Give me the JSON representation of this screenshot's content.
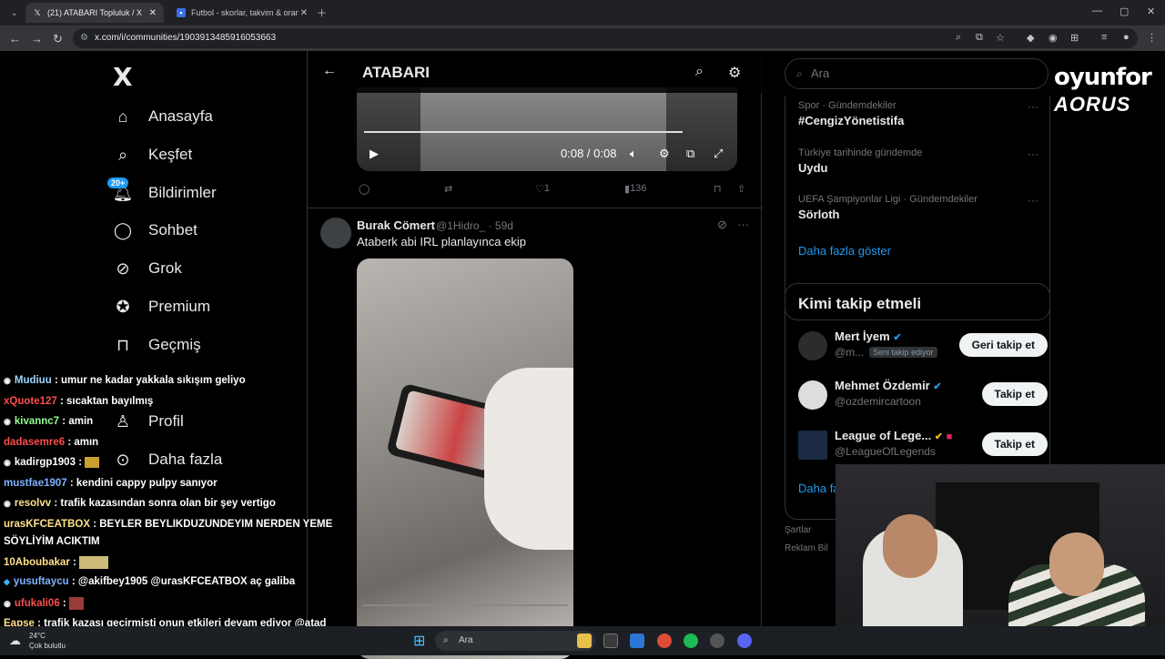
{
  "browser": {
    "tabs": [
      {
        "label": "(21) ATABARI Topluluk / X",
        "active": true
      },
      {
        "label": "Futbol - skorlar, takvim & oranla",
        "active": false
      }
    ],
    "url": "x.com/i/communities/1903913485916053663"
  },
  "sidebar": {
    "logo": "X",
    "notifications_badge": "20+",
    "items": [
      {
        "label": "Anasayfa",
        "icon": "home-icon"
      },
      {
        "label": "Keşfet",
        "icon": "search-icon"
      },
      {
        "label": "Bildirimler",
        "icon": "bell-icon"
      },
      {
        "label": "Sohbet",
        "icon": "chat-icon"
      },
      {
        "label": "Grok",
        "icon": "grok-icon"
      },
      {
        "label": "Premium",
        "icon": "premium-icon"
      },
      {
        "label": "Geçmiş",
        "icon": "bookmark-icon"
      },
      {
        "label": "Profil",
        "icon": "person-icon"
      },
      {
        "label": "Daha fazla",
        "icon": "more-icon"
      }
    ]
  },
  "main": {
    "title": "ATABARI",
    "video1": {
      "time": "0:08 / 0:08"
    },
    "actions": {
      "likes": "1",
      "views": "136"
    },
    "post": {
      "name": "Burak Cömert",
      "handle": "@1Hidro_",
      "age": "· 59d",
      "text": "Ataberk abi IRL planlayınca ekip"
    }
  },
  "right": {
    "search_placeholder": "Ara",
    "trends": [
      {
        "meta": "Spor · Gündemdekiler",
        "name": "#CengizYönetistifa"
      },
      {
        "meta": "Türkiye tarihinde gündemde",
        "name": "Uydu"
      },
      {
        "meta": "UEFA Şampiyonlar Ligi · Gündemdekiler",
        "name": "Sörloth"
      }
    ],
    "show_more": "Daha fazla göster",
    "follow_title": "Kimi takip etmeli",
    "follow": [
      {
        "name": "Mert İyem",
        "handle": "@m...",
        "pill": "Seni takip ediyor",
        "button": "Geri takip et"
      },
      {
        "name": "Mehmet Özdemir",
        "handle": "@ozdemircartoon",
        "button": "Takip et"
      },
      {
        "name": "League of Lege...",
        "handle": "@LeagueOfLegends",
        "button": "Takip et"
      }
    ],
    "follow_more": "Daha fa",
    "footer": [
      "Şartlar",
      "Reklam Bil"
    ]
  },
  "overlay": {
    "brand1": "oyunfor",
    "brand2": "AORUS"
  },
  "chat": [
    {
      "user": "Mudiuu",
      "color": "#9bd5ff",
      "msg": ": umur ne kadar yakkala sıkışım geliyo"
    },
    {
      "user": "xQuote127",
      "color": "#ff4d4d",
      "msg": ": sıcaktan bayılmış"
    },
    {
      "user": "kivannc7",
      "color": "#8fff8f",
      "msg": ": amin"
    },
    {
      "user": "dadasemre6",
      "color": "#ff4d4d",
      "msg": ": amın"
    },
    {
      "user": "kadirgp1903",
      "color": "#ffffff",
      "msg": ":"
    },
    {
      "user": "mustfae1907",
      "color": "#7fb2ff",
      "msg": ": kendini cappy pulpy sanıyor"
    },
    {
      "user": "resolvv",
      "color": "#ffe08a",
      "msg": ": trafik kazasından sonra olan bir şey vertigo"
    },
    {
      "user": "urasKFCEATBOX",
      "color": "#ffe08a",
      "msg": ": BEYLER BEYLIKDUZUNDEYIM NERDEN YEME"
    },
    {
      "user": "",
      "color": "#ffffff",
      "msg": "SÖYLİYİM ACIKTIM"
    },
    {
      "user": "10Aboubakar",
      "color": "#ffe08a",
      "msg": ":"
    },
    {
      "user": "yusuftaycu",
      "color": "#7fb2ff",
      "msg": ": @akifbey1905 @urasKFCEATBOX aç galiba"
    },
    {
      "user": "ufukali06",
      "color": "#ff4d4d",
      "msg": ":"
    },
    {
      "user": "Eapse",
      "color": "#ffe08a",
      "msg": ": trafik kazası geçirmişti onun etkileri devam ediyor @atad"
    }
  ],
  "taskbar": {
    "temp": "24°C",
    "weather": "Çok bulutlu",
    "search": "Ara"
  }
}
